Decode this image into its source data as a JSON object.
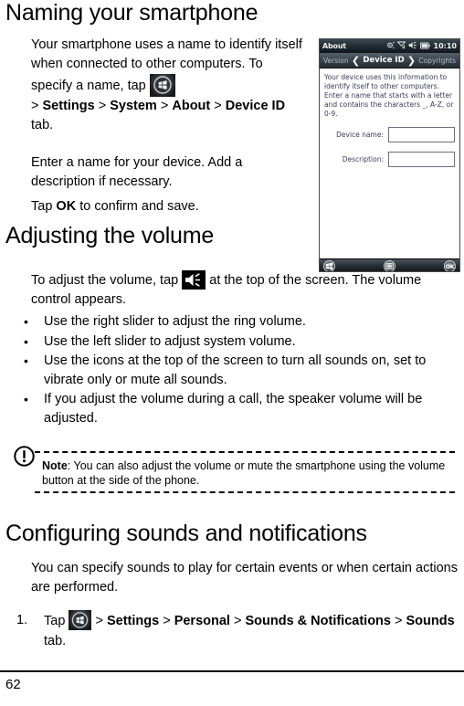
{
  "document": {
    "page_number": "62"
  },
  "sections": {
    "naming": {
      "title": "Naming your smartphone",
      "intro_part1": "Your smartphone uses a name to identify itself when connected to other computers. To specify a name, tap",
      "intro_path_prefix": ">",
      "intro_path": [
        "Settings",
        "System",
        "About",
        "Device ID"
      ],
      "intro_suffix": "tab.",
      "enter_name": "Enter a name for your device. Add a description if necessary.",
      "tap_ok_prefix": "Tap",
      "tap_ok_bold": "OK",
      "tap_ok_suffix": "to confirm and save."
    },
    "volume": {
      "title": "Adjusting the volume",
      "intro_prefix": "To adjust the volume, tap",
      "intro_suffix": "at the top of the screen. The volume control appears.",
      "bullets": [
        "Use the right slider to adjust the ring volume.",
        "Use the left slider to adjust system volume.",
        "Use the icons at the top of the screen to turn all sounds on, set to vibrate only or mute all sounds.",
        "If you adjust the volume during a call, the speaker volume will be adjusted."
      ],
      "note": {
        "label": "Note",
        "separator": ":",
        "text": "You can also adjust the volume or mute the smartphone using the volume button at the side of the phone."
      }
    },
    "sounds": {
      "title": "Configuring sounds and notifications",
      "intro": "You can specify sounds to play for certain events or when certain actions are performed.",
      "step": {
        "number": "1.",
        "prefix": "Tap",
        "path_prefix": ">",
        "path": [
          "Settings",
          "Personal",
          "Sounds & Notifications"
        ],
        "path_last_bold": "Sounds",
        "suffix": "tab."
      }
    }
  },
  "screenshot": {
    "titlebar": {
      "title": "About",
      "clock": "10:10",
      "status_icons": [
        "connectivity-icon",
        "signal-icon",
        "speaker-icon",
        "battery-icon"
      ]
    },
    "tabbar": {
      "left_tab": "Version",
      "active_tab": "Device ID",
      "right_tab": "Copyrights"
    },
    "body": {
      "description": "Your device uses this information to identify itself to other computers. Enter a name that starts with a letter and contains the characters _, A-Z, or 0-9.",
      "fields": [
        {
          "label": "Device name:",
          "value": ""
        },
        {
          "label": "Description:",
          "value": ""
        }
      ]
    },
    "softbar": {
      "start_label": "start-icon",
      "keyboard_label": "keyboard-icon",
      "ok_label": "OK"
    }
  },
  "colors": {
    "text": "#000000",
    "page_bg": "#ffffff",
    "screenshot_chrome_dark": "#1b1c1e",
    "screenshot_label": "#3a3a5a"
  }
}
